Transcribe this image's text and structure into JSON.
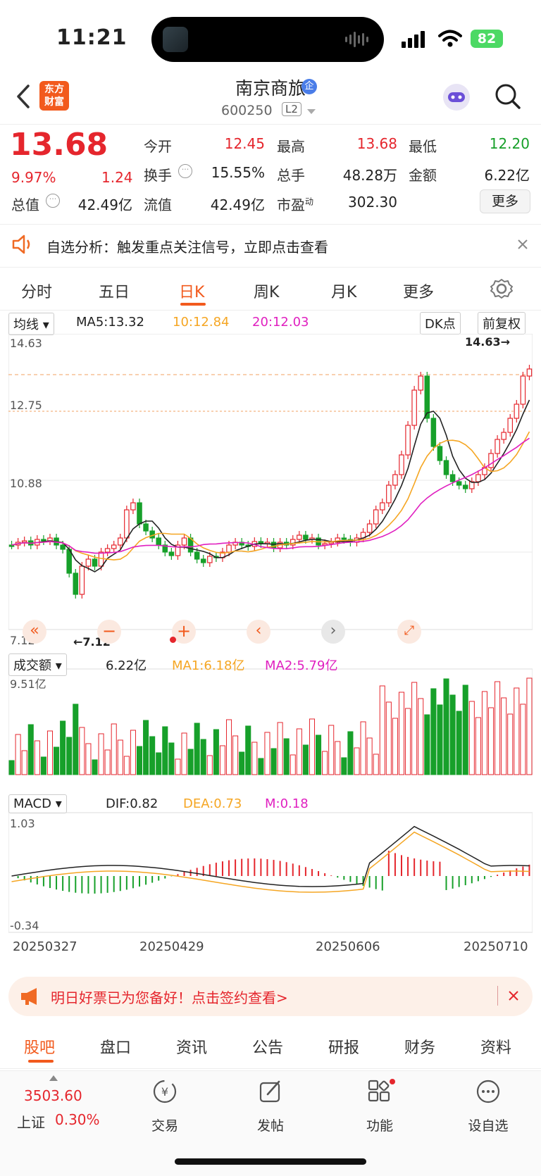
{
  "status_bar": {
    "time": "11:21",
    "battery": "82"
  },
  "header": {
    "brand_line1": "东方",
    "brand_line2": "财富",
    "stock_name": "南京商旅",
    "badge": "企",
    "stock_code": "600250",
    "level": "L2"
  },
  "quote": {
    "price": "13.68",
    "change_pct": "9.97%",
    "change": "1.24",
    "open_label": "今开",
    "open": "12.45",
    "high_label": "最高",
    "high": "13.68",
    "low_label": "最低",
    "low": "12.20",
    "turnover_label": "换手",
    "turnover": "15.55%",
    "volume_label": "总手",
    "volume": "48.28万",
    "amount_label": "金额",
    "amount": "6.22亿",
    "mktcap_label": "总值",
    "mktcap": "42.49亿",
    "float_label": "流值",
    "float": "42.49亿",
    "pe_label": "市盈",
    "pe_sup": "动",
    "pe": "302.30",
    "more": "更多"
  },
  "analysis": {
    "text": "自选分析：触发重点关注信号，立即点击查看"
  },
  "ktabs": [
    "分时",
    "五日",
    "日K",
    "周K",
    "月K",
    "更多"
  ],
  "active_tab": "日K",
  "chart": {
    "ma_select": "均线",
    "ma5": "MA5:13.32",
    "ma10": "10:12.84",
    "ma20": "20:12.03",
    "dk": "DK点",
    "adjust": "前复权",
    "price_top": "14.63",
    "price_mid1": "12.75",
    "price_mid2": "10.88",
    "price_bottom": "7.12",
    "max_mark": "14.63→",
    "min_mark": "←7.12",
    "vol_select": "成交额",
    "vol_value": "6.22亿",
    "vol_ma1": "MA1:6.18亿",
    "vol_ma2": "MA2:5.79亿",
    "vol_top": "9.51亿",
    "macd_select": "MACD",
    "dif": "DIF:0.82",
    "dea": "DEA:0.73",
    "m": "M:0.18",
    "macd_top": "1.03",
    "macd_bottom": "-0.34",
    "dates": [
      "20250327",
      "20250429",
      "20250606",
      "20250710"
    ],
    "colors": {
      "up": "#e5262d",
      "down": "#17a02a",
      "ma5": "#222222",
      "ma10": "#f5a623",
      "ma20": "#e020c0"
    }
  },
  "promo": {
    "text": "明日好票已为您备好！点击签约查看>"
  },
  "bottom_tabs": [
    "股吧",
    "盘口",
    "资讯",
    "公告",
    "研报",
    "财务",
    "资料"
  ],
  "index": {
    "value": "3503.60",
    "name": "上证",
    "pct": "0.30%"
  },
  "toolbar": [
    {
      "label": "交易",
      "icon": "trade-icon"
    },
    {
      "label": "发帖",
      "icon": "post-icon"
    },
    {
      "label": "功能",
      "icon": "apps-icon"
    },
    {
      "label": "设自选",
      "icon": "add-watchlist-icon"
    }
  ]
}
